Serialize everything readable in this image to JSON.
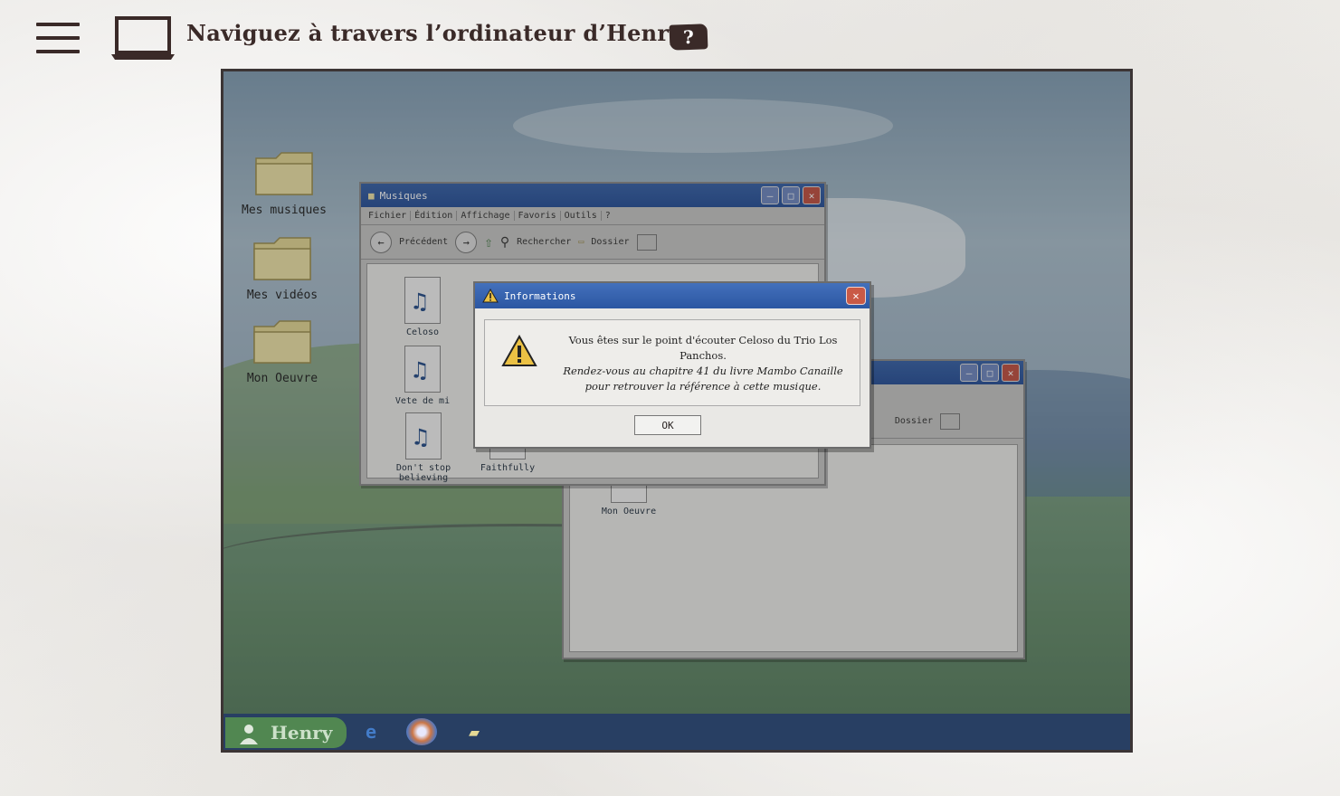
{
  "header": {
    "title": "Naviguez à travers l’ordinateur d’Henry",
    "help_label": "?",
    "icons": [
      "hamburger-menu-icon",
      "laptop-icon"
    ]
  },
  "desktop": {
    "icons": [
      {
        "label": "Mes musiques"
      },
      {
        "label": "Mes vidéos"
      },
      {
        "label": "Mon Oeuvre"
      }
    ]
  },
  "music_window": {
    "title": "Musiques",
    "menu": [
      "Fichier",
      "Édition",
      "Affichage",
      "Favoris",
      "Outils",
      "?"
    ],
    "toolbar": {
      "back": "Précédent",
      "search": "Rechercher",
      "folder": "Dossier"
    },
    "files": [
      "Celoso",
      "Vete de mi",
      "Don't stop believing",
      "Faithfully"
    ]
  },
  "oeuvre_window": {
    "toolbar_folder": "Dossier",
    "files": [
      "Mon Oeuvre"
    ]
  },
  "dialog": {
    "title": "Informations",
    "line1": "Vous êtes sur le point d'écouter Celoso du Trio Los Panchos.",
    "line2": "Rendez-vous au chapitre 41 du livre Mambo Canaille pour retrouver la référence à cette musique.",
    "ok_label": "OK"
  },
  "taskbar": {
    "start_label": "Henry",
    "icons": [
      "internet-explorer-icon",
      "media-player-icon",
      "folder-icon"
    ]
  },
  "colors": {
    "title_text": "#3a2a28",
    "titlebar_blue": "#2457b0",
    "close_red": "#d9563f",
    "taskbar": "#243f6a",
    "start_green": "#4a8a4a"
  }
}
